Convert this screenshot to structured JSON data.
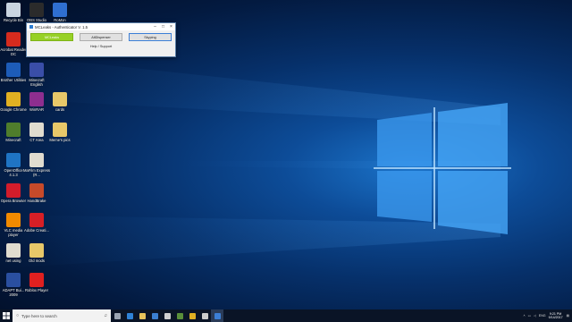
{
  "desktop": {
    "icons": [
      {
        "label": "Recycle Bin",
        "color": "#c9d4e0",
        "icon": "recycle-bin-icon"
      },
      {
        "label": "OBS Studio",
        "color": "#2b2b2b",
        "icon": "obs-icon"
      },
      {
        "label": "RoMon",
        "color": "#2f6fd1",
        "icon": "romon-icon"
      },
      {
        "label": "Acrobat Reader DC",
        "color": "#d62b1e",
        "icon": "acrobat-icon"
      },
      {
        "label": "Brother Utilities",
        "color": "#1d5cb8",
        "icon": "brother-icon"
      },
      {
        "label": "Minecraft English",
        "color": "#3a4ea8",
        "icon": "minecraft-english-icon"
      },
      {
        "label": "Google Chrome",
        "color": "#e0b022",
        "icon": "chrome-icon"
      },
      {
        "label": "WinRAR",
        "color": "#8e2e8f",
        "icon": "winrar-icon"
      },
      {
        "label": "cards",
        "color": "#e8c869",
        "icon": "folder-icon"
      },
      {
        "label": "Minecraft",
        "color": "#4f7d2c",
        "icon": "minecraft-icon"
      },
      {
        "label": "CT Area",
        "color": "#e0dccf",
        "icon": "file-icon"
      },
      {
        "label": "Meme's pics",
        "color": "#e8c869",
        "icon": "folder-icon"
      },
      {
        "label": "OpenOffice 4.1.3",
        "color": "#1f74c4",
        "icon": "openoffice-icon"
      },
      {
        "label": "MaFilm Express (R...",
        "color": "#e0dccf",
        "icon": "file-icon"
      },
      {
        "label": "Opera Browser",
        "color": "#d31c2b",
        "icon": "opera-icon"
      },
      {
        "label": "HandBrake",
        "color": "#c74a2a",
        "icon": "handbrake-icon"
      },
      {
        "label": "VLC media player",
        "color": "#f08a00",
        "icon": "vlc-icon"
      },
      {
        "label": "Adobe Creati...",
        "color": "#d81f26",
        "icon": "adobe-cc-icon"
      },
      {
        "label": "net using",
        "color": "#e0dccf",
        "icon": "file-icon"
      },
      {
        "label": "Old mods",
        "color": "#e8c869",
        "icon": "folder-icon"
      },
      {
        "label": "ADAPT Bui... 2009",
        "color": "#2a4fa0",
        "icon": "adapt-icon"
      },
      {
        "label": "Roblox Player",
        "color": "#e02020",
        "icon": "roblox-icon"
      }
    ]
  },
  "window": {
    "title": "MCLeaks - Authenticator V. 1.5",
    "buttons": [
      "MCLeaks",
      "AltDispenser",
      "Skyping"
    ],
    "help": "Help / Support"
  },
  "taskbar": {
    "search_placeholder": "Type here to search",
    "apps": [
      {
        "icon": "task-view-icon",
        "color": "#9aa4b2"
      },
      {
        "icon": "edge-icon",
        "color": "#2f82d6"
      },
      {
        "icon": "file-explorer-icon",
        "color": "#e8c35a"
      },
      {
        "icon": "store-icon",
        "color": "#3b7fd0"
      },
      {
        "icon": "media-icon",
        "color": "#d0d0d0"
      },
      {
        "icon": "minecraft-taskbar-icon",
        "color": "#5a8f3a"
      },
      {
        "icon": "chrome-taskbar-icon",
        "color": "#e0b022"
      },
      {
        "icon": "obs-taskbar-icon",
        "color": "#cccccc"
      },
      {
        "icon": "authenticator-taskbar-icon",
        "color": "#3c7fd6"
      }
    ],
    "lang": "ENG",
    "time": "9:21 PM",
    "date": "9/14/2017"
  }
}
